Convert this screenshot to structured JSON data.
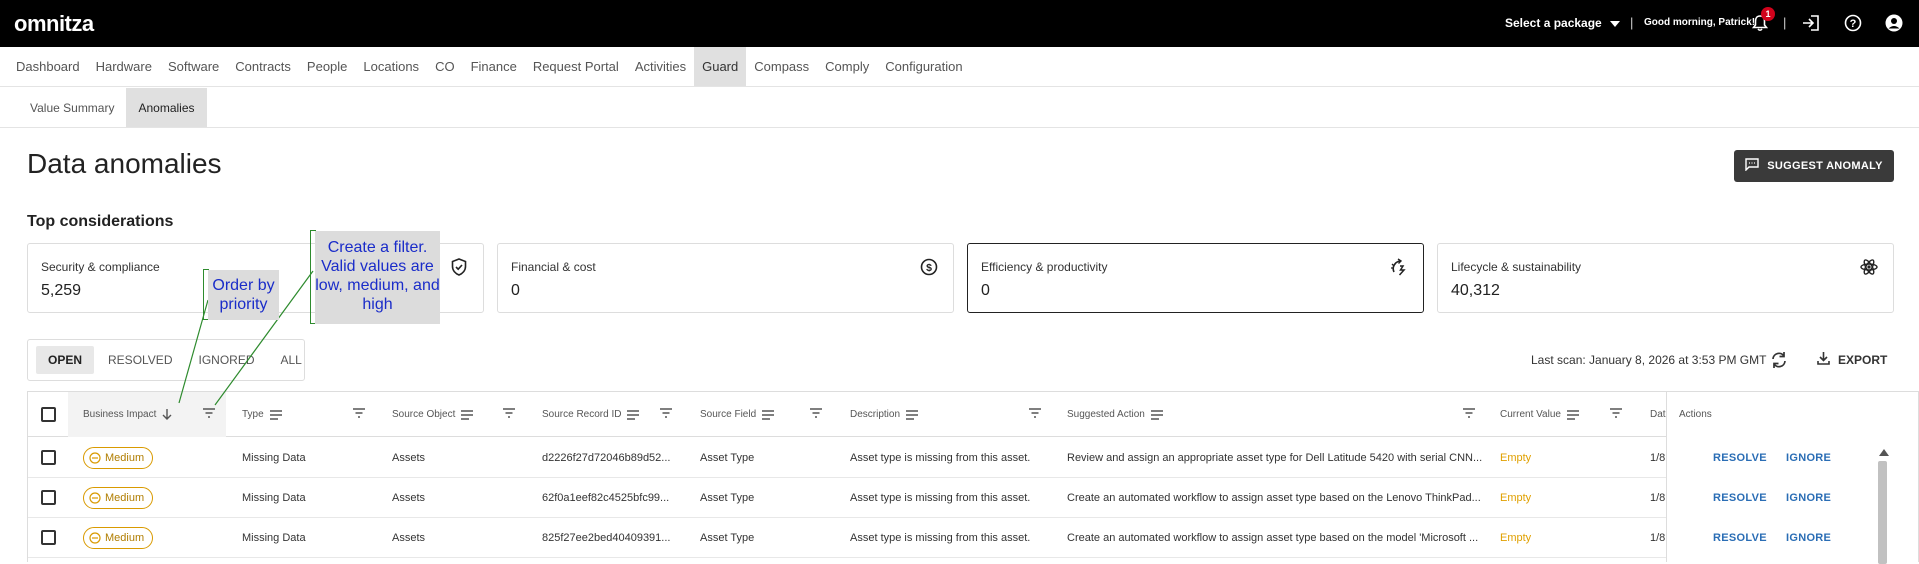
{
  "topbar": {
    "logo": "omnitza",
    "package_label": "Select a package",
    "greeting": "Good morning, Patrick!",
    "notification_count": "1",
    "icons": [
      "bell-icon",
      "logout-icon",
      "help-icon",
      "account-icon"
    ]
  },
  "nav": {
    "items": [
      "Dashboard",
      "Hardware",
      "Software",
      "Contracts",
      "People",
      "Locations",
      "CO",
      "Finance",
      "Request Portal",
      "Activities",
      "Guard",
      "Compass",
      "Comply",
      "Configuration"
    ],
    "active": "Guard"
  },
  "subnav": {
    "items": [
      "Value Summary",
      "Anomalies"
    ],
    "active": "Anomalies"
  },
  "page": {
    "title": "Data anomalies",
    "suggest_button": "SUGGEST ANOMALY",
    "section_title": "Top considerations"
  },
  "cards": [
    {
      "label": "Security & compliance",
      "value": "5,259",
      "icon": "shield-check-icon"
    },
    {
      "label": "Financial & cost",
      "value": "0",
      "icon": "dollar-circle-icon"
    },
    {
      "label": "Efficiency & productivity",
      "value": "0",
      "icon": "efficiency-icon",
      "selected": true
    },
    {
      "label": "Lifecycle & sustainability",
      "value": "40,312",
      "icon": "atom-icon"
    }
  ],
  "filter_tabs": {
    "items": [
      "OPEN",
      "RESOLVED",
      "IGNORED",
      "ALL"
    ],
    "active": "OPEN"
  },
  "scan": {
    "last_scan": "Last scan: January 8, 2026 at 3:53 PM GMT",
    "export_label": "EXPORT"
  },
  "table": {
    "columns": [
      "Business Impact",
      "Type",
      "Source Object",
      "Source Record ID",
      "Source Field",
      "Description",
      "Suggested Action",
      "Current Value",
      "Dat",
      "Actions"
    ],
    "rows": [
      {
        "impact": "Medium",
        "type": "Missing Data",
        "source_object": "Assets",
        "record_id": "d2226f27d72046b89d52...",
        "field": "Asset Type",
        "description": "Asset type is missing from this asset.",
        "action": "Review and assign an appropriate asset type for Dell Latitude 5420 with serial CNN...",
        "current_value": "Empty",
        "date": "1/8"
      },
      {
        "impact": "Medium",
        "type": "Missing Data",
        "source_object": "Assets",
        "record_id": "62f0a1eef82c4525bfc99...",
        "field": "Asset Type",
        "description": "Asset type is missing from this asset.",
        "action": "Create an automated workflow to assign asset type based on the Lenovo ThinkPad...",
        "current_value": "Empty",
        "date": "1/8"
      },
      {
        "impact": "Medium",
        "type": "Missing Data",
        "source_object": "Assets",
        "record_id": "825f27ee2bed40409391...",
        "field": "Asset Type",
        "description": "Asset type is missing from this asset.",
        "action": "Create an automated workflow to assign asset type based on the model 'Microsoft ...",
        "current_value": "Empty",
        "date": "1/8"
      }
    ],
    "resolve_label": "RESOLVE",
    "ignore_label": "IGNORE"
  },
  "annotations": {
    "order": "Order by priority",
    "filter": "Create a filter. Valid values are low, medium, and high"
  }
}
